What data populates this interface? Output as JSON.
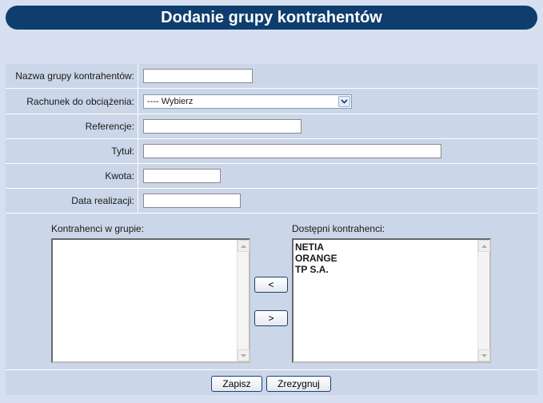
{
  "page": {
    "title": "Dodanie grupy kontrahentów"
  },
  "form": {
    "group_name": {
      "label": "Nazwa grupy kontrahentów:",
      "value": ""
    },
    "account": {
      "label": "Rachunek do obciążenia:",
      "selected": "---- Wybierz"
    },
    "reference": {
      "label": "Referencje:",
      "value": ""
    },
    "title_field": {
      "label": "Tytuł:",
      "value": ""
    },
    "amount": {
      "label": "Kwota:",
      "value": ""
    },
    "date": {
      "label": "Data realizacji:",
      "value": ""
    }
  },
  "lists": {
    "in_group": {
      "label": "Kontrahenci w grupie:",
      "items": []
    },
    "available": {
      "label": "Dostępni kontrahenci:",
      "items": [
        "NETIA",
        "ORANGE",
        "TP S.A."
      ]
    },
    "move_left_label": "<",
    "move_right_label": ">"
  },
  "actions": {
    "save_label": "Zapisz",
    "cancel_label": "Zrezygnuj"
  },
  "icons": {
    "dropdown": "chevron-down-icon",
    "scroll_up": "scroll-up-arrow-icon",
    "scroll_down": "scroll-down-arrow-icon"
  },
  "colors": {
    "title_bg": "#0f3e6e",
    "page_bg": "#d6e0f0",
    "panel_bg": "#cbd6e8"
  }
}
